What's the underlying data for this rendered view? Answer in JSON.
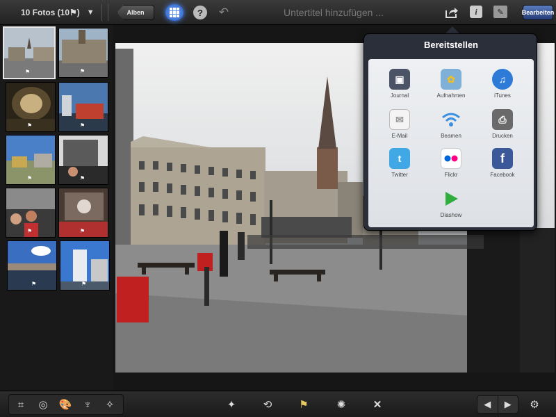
{
  "topbar": {
    "album_count": "10 Fotos (10⚑)",
    "back_label": "Alben",
    "help_label": "?",
    "subtitle_placeholder": "Untertitel hinzufügen ...",
    "info_label": "i",
    "edit_label": "Bearbeiten"
  },
  "share_popover": {
    "title": "Bereitstellen",
    "items": [
      {
        "label": "Journal",
        "icon": "journal-icon",
        "color": "#4a5466"
      },
      {
        "label": "Aufnahmen",
        "icon": "sunflower-icon",
        "color": "#7fb0d8"
      },
      {
        "label": "iTunes",
        "icon": "itunes-icon",
        "color": "#2d7bd6"
      },
      {
        "label": "E-Mail",
        "icon": "mail-icon",
        "color": "#e8e8e8"
      },
      {
        "label": "Beamen",
        "icon": "wifi-icon",
        "color": "#3a8fe0"
      },
      {
        "label": "Drucken",
        "icon": "printer-icon",
        "color": "#6a6a6a"
      },
      {
        "label": "Twitter",
        "icon": "twitter-icon",
        "color": "#41a8e6"
      },
      {
        "label": "Flickr",
        "icon": "flickr-icon",
        "color": "#ffffff"
      },
      {
        "label": "Facebook",
        "icon": "facebook-icon",
        "color": "#3b5998"
      },
      {
        "label": "Diashow",
        "icon": "play-icon",
        "color": "#2fae3e"
      }
    ]
  },
  "colors": {
    "accent": "#2b5fbf",
    "popover_bg": "#2b2f3a"
  }
}
